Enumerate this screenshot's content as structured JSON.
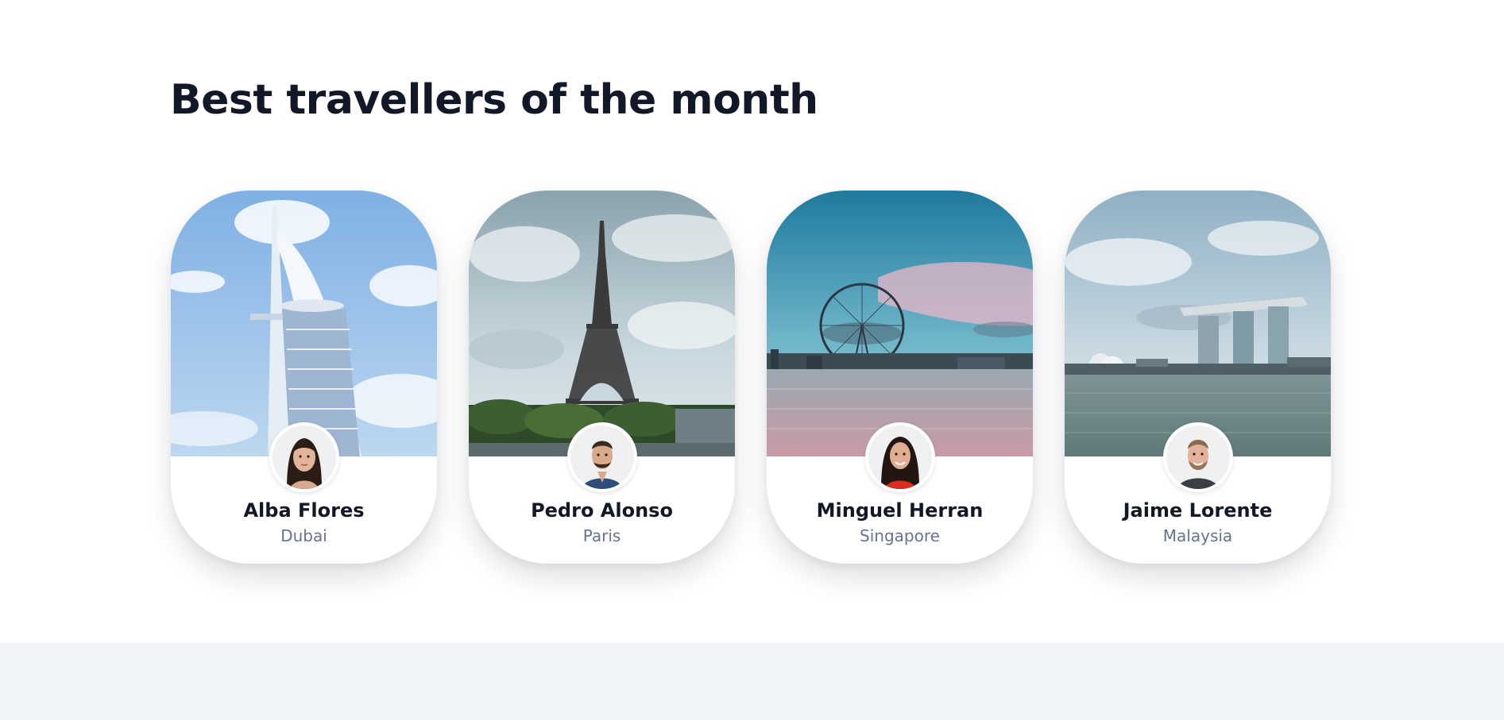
{
  "section": {
    "title": "Best travellers of the month"
  },
  "travellers": [
    {
      "name": "Alba Flores",
      "city": "Dubai"
    },
    {
      "name": "Pedro Alonso",
      "city": "Paris"
    },
    {
      "name": "Minguel Herran",
      "city": "Singapore"
    },
    {
      "name": "Jaime Lorente",
      "city": "Malaysia"
    }
  ],
  "colors": {
    "heading": "#111827",
    "subtext": "#64748b",
    "footer_band": "#f1f4f9"
  },
  "icons": {
    "card_1_photo": "burj-al-arab-photo",
    "card_2_photo": "eiffel-tower-photo",
    "card_3_photo": "singapore-flyer-photo",
    "card_4_photo": "marina-bay-sands-photo"
  }
}
